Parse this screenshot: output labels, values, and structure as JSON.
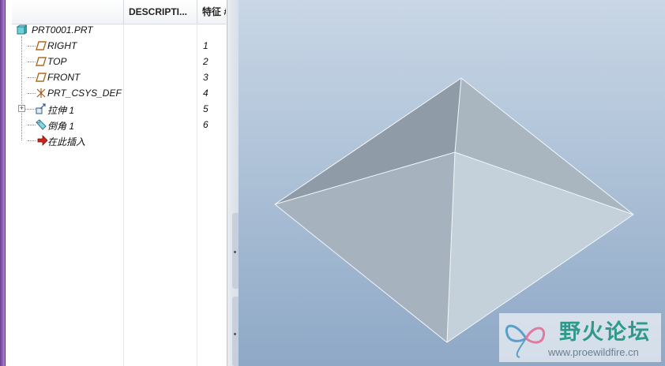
{
  "model_tree": {
    "columns": [
      "DESCRIPTI...",
      "特征 #"
    ],
    "root": {
      "label": "PRT0001.PRT",
      "icon": "part-icon"
    },
    "items": [
      {
        "label": "RIGHT",
        "number": "1",
        "icon": "datum-plane-icon"
      },
      {
        "label": "TOP",
        "number": "2",
        "icon": "datum-plane-icon"
      },
      {
        "label": "FRONT",
        "number": "3",
        "icon": "datum-plane-icon"
      },
      {
        "label": "PRT_CSYS_DEF",
        "number": "4",
        "icon": "coordinate-system-icon"
      },
      {
        "label": "拉伸 1",
        "number": "5",
        "icon": "extrude-icon",
        "expandable": true
      },
      {
        "label": "倒角 1",
        "number": "6",
        "icon": "chamfer-icon"
      },
      {
        "label": "在此插入",
        "number": "",
        "icon": "insert-here-arrow-icon"
      }
    ]
  },
  "viewport": {
    "background_top": "#c9d7e6",
    "background_bottom": "#8ea8c6",
    "model_face_colors": [
      "#8f9ca8",
      "#aab6bf",
      "#a6b3be",
      "#c5d1da"
    ],
    "model_edge_color": "#f2f6fa"
  },
  "watermark": {
    "title": "野火论坛",
    "url": "www.proewildfire.cn"
  }
}
